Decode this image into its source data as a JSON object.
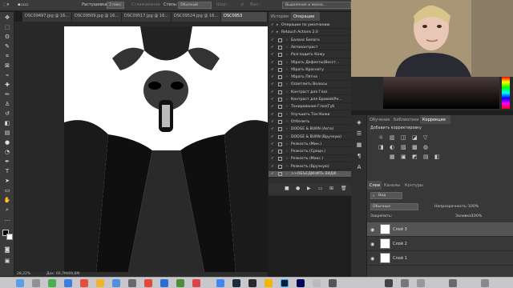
{
  "options_bar": {
    "feather_label": "Растушевка:",
    "feather_value": "3 пикс.",
    "antialias_label": "Сглаживание",
    "style_label": "Стиль:",
    "style_value": "Обычный",
    "width_label": "Шир.:",
    "height_label": "Выс.:",
    "mask_button": "Выделение и маска..."
  },
  "doc_tabs": [
    {
      "label": "DSC09497.jpg @ 16..."
    },
    {
      "label": "DSC09509.jpg @ 16..."
    },
    {
      "label": "DSC09517.jpg @ 16..."
    },
    {
      "label": "DSC09524.jpg @ 16..."
    },
    {
      "label": "DSC0953"
    }
  ],
  "status": {
    "zoom": "28,22%",
    "doc_info": "Док: 60,7M/69,6M"
  },
  "actions_panel": {
    "tabs": [
      {
        "label": "История"
      },
      {
        "label": "Операции"
      }
    ],
    "rows": [
      {
        "label": "Операции по умолчанию"
      },
      {
        "label": "Retouch Actions 2.0"
      },
      {
        "label": "Баланс Белого"
      },
      {
        "label": "Автоконтраст"
      },
      {
        "label": "Разгладить Кожу"
      },
      {
        "label": "Убрать Дефекты(Восст..."
      },
      {
        "label": "Убрать Красноту"
      },
      {
        "label": "Убрать Пятна"
      },
      {
        "label": "Осветлить Волосы"
      },
      {
        "label": "Контраст для Глаз"
      },
      {
        "label": "Контраст для Бровей(Ре..."
      },
      {
        "label": "Тонирование Глаз(Губ"
      },
      {
        "label": "Улучшить Тон Кожи"
      },
      {
        "label": "Отбелить"
      },
      {
        "label": "DODGE & BURN (Авто)"
      },
      {
        "label": "DODGE & BURN (Вручную)"
      },
      {
        "label": "Резкость (Мин.)"
      },
      {
        "label": "Резкость (Средн.)"
      },
      {
        "label": "Резкость (Макс.)"
      },
      {
        "label": "Резкость (Вручную)"
      },
      {
        "label": ">>ОБЪЕДИНИТЬ ВИДИ..."
      }
    ]
  },
  "adjustments_panel": {
    "tabs": [
      {
        "label": "Обучение"
      },
      {
        "label": "Библиотеки"
      },
      {
        "label": "Коррекция"
      }
    ],
    "add_label": "Добавить корректировку"
  },
  "layers_panel": {
    "tabs": [
      {
        "label": "Слои"
      },
      {
        "label": "Каналы"
      },
      {
        "label": "Контуры"
      }
    ],
    "filter_label": "Вид",
    "blend_mode": "Обычные",
    "opacity_label": "Непрозрачность:",
    "opacity_value": "100%",
    "lock_label": "Закрепить:",
    "fill_label": "Заливка:",
    "fill_value": "100%",
    "layers": [
      {
        "name": "Слой 3"
      },
      {
        "name": "Слой 2"
      },
      {
        "name": "Слой 1"
      }
    ]
  },
  "colors": {
    "ps_dark": "#2e2e2e",
    "panel": "#383838",
    "accent_selection": "#545454",
    "dock": "#c7c7cc"
  }
}
